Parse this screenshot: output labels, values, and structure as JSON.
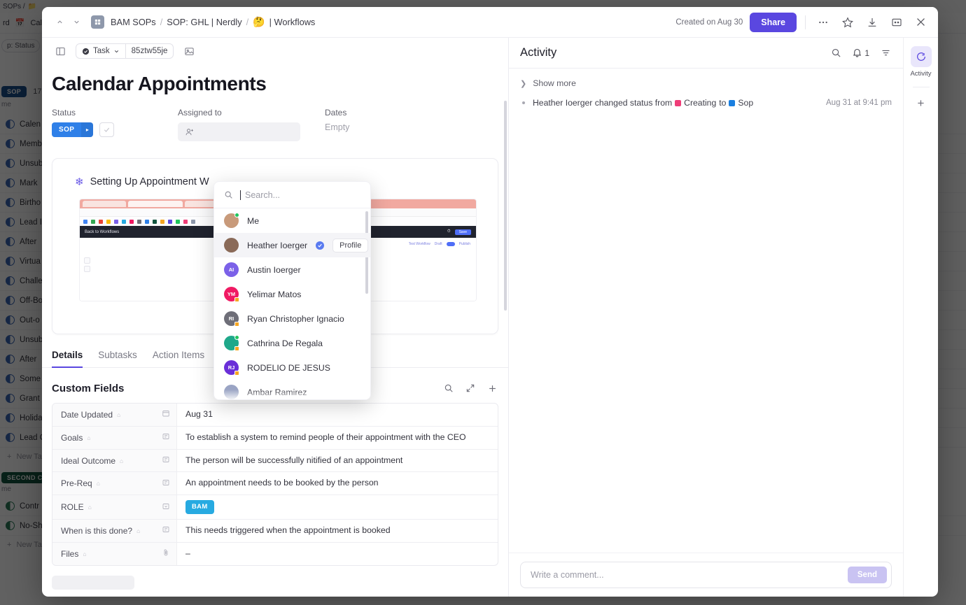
{
  "background": {
    "topbar_text": "SOPs  /",
    "folder_icon": "folder-icon",
    "tabs": [
      {
        "label": "rd",
        "icon": ""
      },
      {
        "label": "Cale",
        "icon": "calendar-icon"
      }
    ],
    "filters": [
      {
        "label": "p: Status"
      },
      {
        "label": ""
      }
    ],
    "group1": {
      "pill": "SOP",
      "count": "17",
      "name_col": "me"
    },
    "rows1": [
      "Calen",
      "Memb",
      "Unsub",
      "Mark",
      "Birtho",
      "Lead I",
      "After",
      "Virtua",
      "Challe",
      "Off-Bo",
      "Out-o",
      "Unsub",
      "After",
      "Some",
      "Grant",
      "Holida",
      "Lead C"
    ],
    "new_task_label": "New Ta",
    "group2": {
      "pill": "SECOND CH",
      "name_col": "me"
    },
    "rows2": [
      "Contr",
      "No-Sh"
    ]
  },
  "header": {
    "nav_up_icon": "chevron-up-icon",
    "nav_down_icon": "chevron-down-icon",
    "workspace_icon": "workspace-icon",
    "breadcrumb": [
      {
        "label": "BAM SOPs"
      },
      {
        "label": "SOP: GHL | Nerdly"
      },
      {
        "label": "| Workflows",
        "emoji": "🤔"
      }
    ],
    "created_on": "Created on Aug 30",
    "share_label": "Share",
    "icons": [
      "ellipsis-icon",
      "star-icon",
      "download-icon",
      "fullscreen-icon",
      "close-icon"
    ]
  },
  "toolbar": {
    "panel_toggle_icon": "panel-toggle-icon",
    "type_label": "Task",
    "type_chevron": "chevron-down-icon",
    "task_id": "85ztw55je",
    "cover_icon": "image-icon"
  },
  "task": {
    "title": "Calendar Appointments",
    "props": {
      "status_label": "Status",
      "status_value": "SOP",
      "status_arrow": "▸",
      "status_color": "#2f80e8",
      "check_icon": "check-icon",
      "assigned_label": "Assigned to",
      "assigned_placeholder_icon": "add-person-icon",
      "dates_label": "Dates",
      "dates_value": "Empty"
    }
  },
  "embed": {
    "icon": "snowflake-icon",
    "title": "Setting Up Appointment W",
    "browser_nav_back": "Back to Workflows",
    "browser_save": "Save",
    "browser_test": "Test Workflow",
    "browser_draft": "Draft",
    "browser_publish": "Publish"
  },
  "tabs": [
    {
      "label": "Details",
      "active": true
    },
    {
      "label": "Subtasks",
      "active": false
    },
    {
      "label": "Action Items",
      "active": false
    }
  ],
  "custom_fields": {
    "title": "Custom Fields",
    "actions": [
      "search-icon",
      "expand-icon",
      "plus-icon"
    ],
    "rows": [
      {
        "key": "Date Updated",
        "type_icon": "calendar-icon",
        "value": "Aug 31",
        "kind": "text"
      },
      {
        "key": "Goals",
        "type_icon": "text-field-icon",
        "value": "To establish a system to remind people of their appointment with the CEO",
        "kind": "text"
      },
      {
        "key": "Ideal Outcome",
        "type_icon": "text-field-icon",
        "value": "The person will be successfully nitified of an appointment",
        "kind": "text"
      },
      {
        "key": "Pre-Req",
        "type_icon": "text-field-icon",
        "value": "An appointment needs to be booked by the person",
        "kind": "text"
      },
      {
        "key": "ROLE",
        "type_icon": "dropdown-icon",
        "value": "BAM",
        "kind": "pill",
        "pill_color": "#27aae1"
      },
      {
        "key": "When is this done?",
        "type_icon": "text-field-icon",
        "value": "This needs triggered when the appointment is booked",
        "kind": "text"
      },
      {
        "key": "Files",
        "type_icon": "paperclip-icon",
        "value": "–",
        "kind": "text"
      }
    ]
  },
  "assignee_dropdown": {
    "search_placeholder": "Search...",
    "search_value": "",
    "profile_label": "Profile",
    "items": [
      {
        "name": "Me",
        "initials": "",
        "color": "#c89a7a",
        "photo": true,
        "status": "online",
        "verified": false,
        "show_profile": false,
        "selected": false
      },
      {
        "name": "Heather Ioerger",
        "initials": "",
        "color": "#8a6a58",
        "photo": true,
        "status": "none",
        "verified": true,
        "show_profile": true,
        "selected": true
      },
      {
        "name": "Austin Ioerger",
        "initials": "AI",
        "color": "#7b61e8",
        "photo": false,
        "status": "none",
        "verified": false,
        "show_profile": false,
        "selected": false
      },
      {
        "name": "Yelimar Matos",
        "initials": "YM",
        "color": "#f01a63",
        "photo": false,
        "status": "away",
        "verified": false,
        "show_profile": false,
        "selected": false
      },
      {
        "name": "Ryan Christopher Ignacio",
        "initials": "RI",
        "color": "#6e6e78",
        "photo": false,
        "status": "away",
        "verified": false,
        "show_profile": false,
        "selected": false
      },
      {
        "name": "Cathrina De Regala",
        "initials": "",
        "color": "#1fa88a",
        "photo": true,
        "status": "online-away",
        "verified": false,
        "show_profile": false,
        "selected": false
      },
      {
        "name": "RODELIO DE JESUS",
        "initials": "RJ",
        "color": "#6a2fd8",
        "photo": false,
        "status": "away",
        "verified": false,
        "show_profile": false,
        "selected": false
      },
      {
        "name": "Ambar Ramirez",
        "initials": "",
        "color": "#9aa4c4",
        "photo": true,
        "status": "none",
        "verified": false,
        "show_profile": false,
        "selected": false
      }
    ]
  },
  "activity": {
    "title": "Activity",
    "search_icon": "search-icon",
    "bell_icon": "bell-icon",
    "bell_count": "1",
    "filter_icon": "filter-icon",
    "show_more": "Show more",
    "items": [
      {
        "prefix": "Heather Ioerger changed status from",
        "from_status": "Creating",
        "from_color": "#ef3d78",
        "middle": "to",
        "to_status": "Sop",
        "to_color": "#1a7fe0",
        "time": "Aug 31 at 9:41 pm"
      }
    ],
    "comment_placeholder": "Write a comment...",
    "send_label": "Send"
  },
  "rail": {
    "activity_icon": "activity-icon",
    "activity_label": "Activity",
    "add_label": "+"
  }
}
